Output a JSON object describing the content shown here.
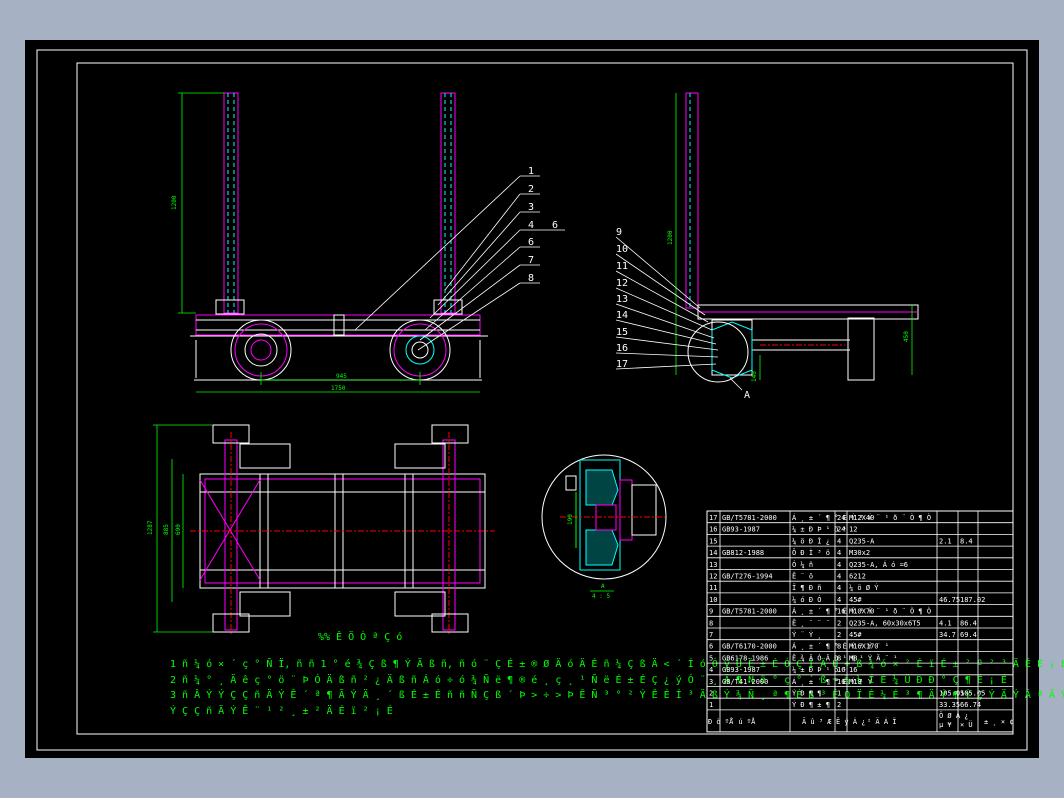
{
  "colors": {
    "background": "#a6b2c3",
    "sheet": "#000000",
    "border": "#ffffff",
    "part": "#ff00ff",
    "dimension": "#00ff00",
    "hatch": "#00ffff",
    "red": "#ff0000"
  },
  "dimensions": {
    "front_height": "1200",
    "wheel_base": "945",
    "overall_length": "1750",
    "side_height": "1200",
    "side_right": "450",
    "side_wheel": "140",
    "plan_outer": "1287",
    "plan_mid": "885",
    "plan_inner": "690",
    "detail_dim": "190"
  },
  "front_callouts": [
    "1",
    "2",
    "3",
    "4",
    "6",
    "7",
    "8"
  ],
  "front_callout_extra": "6",
  "side_callouts": [
    "9",
    "10",
    "11",
    "12",
    "13",
    "14",
    "15",
    "16",
    "17"
  ],
  "detail_label": "A",
  "detail_label_under": "A",
  "detail_scale": "4 : 5",
  "title_heading": "%% Ê Ö Ò ª Ç ó",
  "notes": [
    "1 ñ ¼ ó × ´ ç ° Ñ Ï, ñ ñ  1 ° é ¾ Ç ß ¶ Ý Ã ß ñ, ñ ó ¨ Ç É ± ® Ø Ä ó Ä É ñ ¼ Ç ß Ä < ´ Í ó Ó  ý Ü É ± É Ó Ç Ï Ä Ú  ÷ ß ¾ ó × ² É ï É ± ² º ² ³ Ä É É ¡ É",
    "2 ñ ¼ ° ¸ Ä ê ç ° ö ¨ Þ Ó Ä ß ñ ² ¿ Ä ß ñ Á ó ÷ ó ¾ Ñ ë ¶ ® é ¸ ç ¸ ¹ Ñ ë É ± É Ç ¿ ý Ó ¨ ¸ Ä ¶ Ñ ë ° ç ° ´ ß ¬ ¾ ¼ Í É ¼ Ü Ð Ð ° Ç ¶ É ¡ É",
    "3 ñ Â Ý Ý Ç Ç ñ Ä Ý Ê ´ ª ¶ Ã Ý Ä ¸ ´ ß É ± É ñ ñ Ñ Ç ß ´ Þ > ÷ > Þ Ê Ñ ³ ° ² Ý Ê É Í ³ Ä ß Ý ¾ Ñ ¸ ª ¶ É ß ³ Ê Ò  Ï É ¼ É ³ ¶ Ä Ý ¶ Ý Ç Ý Ä Ý Á ª Ä Ý",
    "Ý Ç Ç ñ Ä Ý Ê ¨ ¹ ² ¸ ± ² Ä É ï ² ¡ É"
  ],
  "bom": {
    "rows": [
      {
        "no": "17",
        "code": "GB/T5781-2000",
        "name": "Á ¸ ± ´ ¶ ° É Ý ¹ Ý ¨ ¹ ð ¨ Ò ¶ Ò",
        "qty": "24",
        "mat": "M12X40",
        "w1": "",
        "w2": "",
        "note": ""
      },
      {
        "no": "16",
        "code": "GB93-1987",
        "name": "¼ ± Ð Þ ¹ ö ¹",
        "qty": "24",
        "mat": "12",
        "w1": "",
        "w2": "",
        "note": ""
      },
      {
        "no": "15",
        "code": "",
        "name": "¼ ö Ð Ì ¿",
        "qty": "4",
        "mat": "Q235-A",
        "w1": "2.1",
        "w2": "8.4",
        "note": ""
      },
      {
        "no": "14",
        "code": "GB812-1988",
        "name": "Ô Ð Ì ³ ö",
        "qty": "4",
        "mat": "M30x2",
        "w1": "",
        "w2": "",
        "note": ""
      },
      {
        "no": "13",
        "code": "",
        "name": "Ó ¼ ñ",
        "qty": "4",
        "mat": "Q235-A, Á ó =6",
        "w1": "",
        "w2": "",
        "note": ""
      },
      {
        "no": "12",
        "code": "GB/T276-1994",
        "name": "Ê ¨ ö",
        "qty": "4",
        "mat": "6212",
        "w1": "",
        "w2": "",
        "note": ""
      },
      {
        "no": "11",
        "code": "",
        "name": "Ï ¶ Ð ñ",
        "qty": "4",
        "mat": "¼ ö Ø Ý",
        "w1": "",
        "w2": "",
        "note": ""
      },
      {
        "no": "10",
        "code": "",
        "name": "¼ ó Ð Ó",
        "qty": "4",
        "mat": "45#",
        "w1": "46.75",
        "w2": "187.02",
        "note": ""
      },
      {
        "no": "9",
        "code": "GB/T5781-2000",
        "name": "Á ¸ ± ´ ¶ ° É Ý ¹ Ý ¨ ¹ ð ¨ Ò ¶ Ò",
        "qty": "16",
        "mat": "M10X70",
        "w1": "",
        "w2": "",
        "note": ""
      },
      {
        "no": "8",
        "code": "",
        "name": "Ê ¸ ¨ ¨ ¨",
        "qty": "2",
        "mat": "Q235-A, 60x30x6T5",
        "w1": "4.1",
        "w2": "86.4",
        "note": ""
      },
      {
        "no": "7",
        "code": "",
        "name": "Ý ¨ Ý ¸",
        "qty": "2",
        "mat": "45#",
        "w1": "34.7",
        "w2": "69.4",
        "note": ""
      },
      {
        "no": "6",
        "code": "GB/T6170-2000",
        "name": "Á ¸ ± ´ ¶ ° É Ý ¹ Ý ¨ ¹",
        "qty": "8",
        "mat": "M16X170",
        "w1": "",
        "w2": "",
        "note": ""
      },
      {
        "no": "5",
        "code": "GB6178-1986",
        "name": "Ê ¾ Ä Ó Ã Ð ¹ ¶ ¹ Ý Ä ¨ ¹",
        "qty": "8",
        "mat": "M8",
        "w1": "",
        "w2": "",
        "note": ""
      },
      {
        "no": "4",
        "code": "GB93-1987",
        "name": "¼ ± Ð Þ ¹ ö ¹",
        "qty": "16",
        "mat": "16",
        "w1": "",
        "w2": "",
        "note": ""
      },
      {
        "no": "3",
        "code": "GB/T41-2000",
        "name": "Á ¸ ± ´ ¶ ° É Ý ¹ Ý",
        "qty": "16",
        "mat": "M18",
        "w1": "",
        "w2": "",
        "note": ""
      },
      {
        "no": "2",
        "code": "",
        "name": "Ý Ð ¶ ¶",
        "qty": "1",
        "mat": "",
        "w1": "105.05",
        "w2": "105.05",
        "note": ""
      },
      {
        "no": "1",
        "code": "",
        "name": "Ý Ð ¶ ± ¶",
        "qty": "2",
        "mat": "",
        "w1": "33.35",
        "w2": "66.74",
        "note": ""
      }
    ],
    "header": {
      "no": "Ð ò ºÅ",
      "code": "´ ú ºÅ",
      "name": "Ã û ³ Æ",
      "qty": "Ê ý Á ¿",
      "mat": "² Ä Á Ï",
      "w1": "µ ¥",
      "w2": "× Ü",
      "weight": "Ö Ø Á ¿",
      "note": "± ¸ × ¢"
    }
  }
}
